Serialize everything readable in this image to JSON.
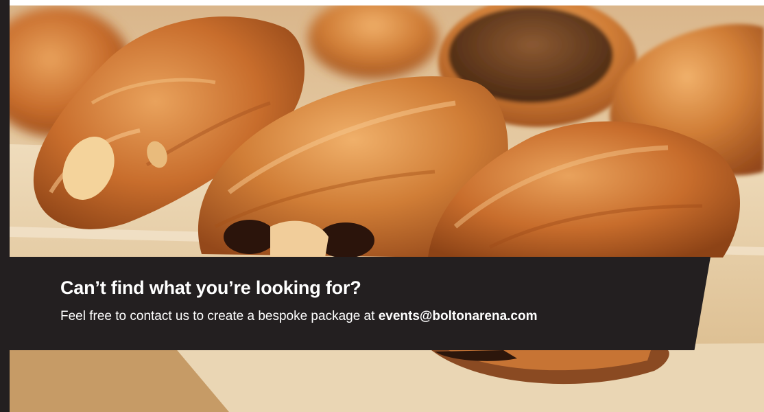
{
  "banner": {
    "title": "Can’t find what you’re looking for?",
    "message": "Feel free to contact us to create a bespoke package at ",
    "email": "events@boltonarena.com"
  },
  "colors": {
    "banner_bg": "#231f20",
    "banner_text": "#ffffff",
    "pastry": "#c9722e",
    "tray": "#e7cfa8"
  },
  "image": {
    "subject": "pastries-photo"
  }
}
